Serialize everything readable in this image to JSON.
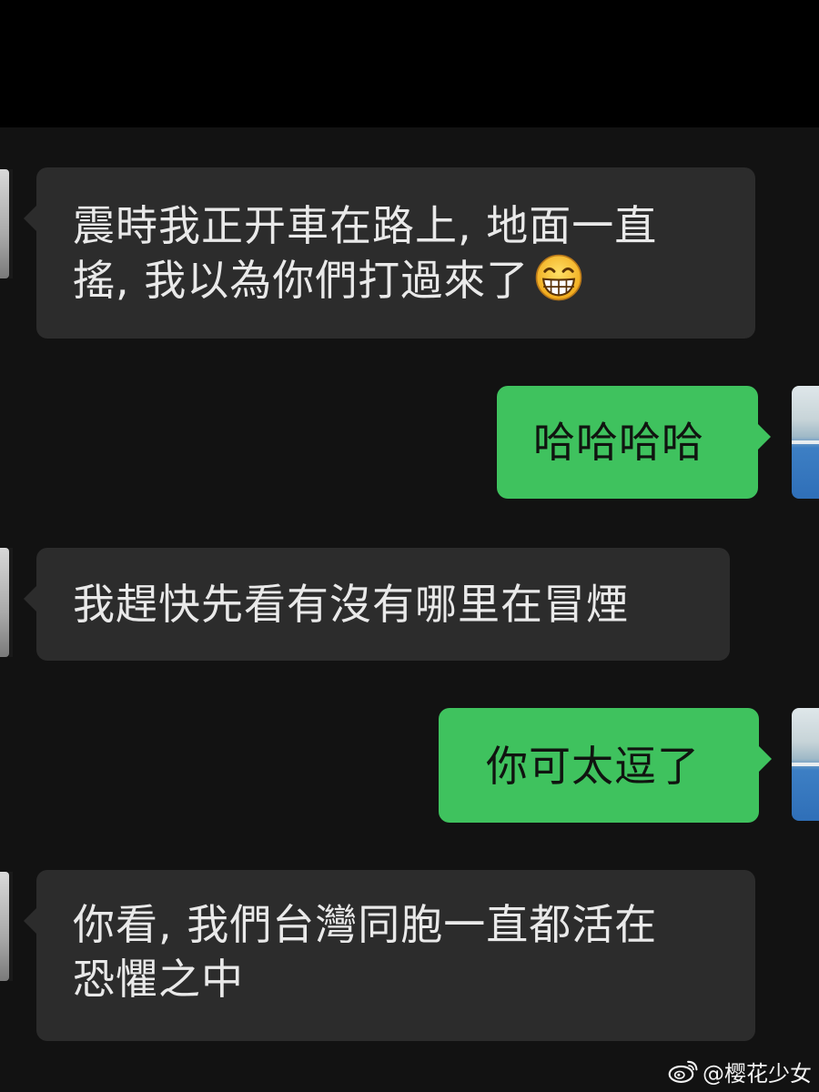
{
  "conversation": {
    "messages": [
      {
        "direction": "incoming",
        "lines": [
          "震時我正开車在路上, 地面一直",
          "搖, 我以為你們打過來了"
        ],
        "emoji": "grinning-face-emoji"
      },
      {
        "direction": "outgoing",
        "lines": [
          "哈哈哈哈"
        ]
      },
      {
        "direction": "incoming",
        "lines": [
          "我趕快先看有沒有哪里在冒煙"
        ]
      },
      {
        "direction": "outgoing",
        "lines": [
          "你可太逗了"
        ]
      },
      {
        "direction": "incoming",
        "lines": [
          "你看, 我們台灣同胞一直都活在",
          "恐懼之中"
        ]
      }
    ]
  },
  "watermark": {
    "icon": "weibo-icon",
    "text": "@樱花少女"
  },
  "colors": {
    "background": "#121212",
    "incoming_bubble": "#2c2c2c",
    "outgoing_bubble": "#3fc25e",
    "incoming_text": "#e9e9e9",
    "outgoing_text": "#101410"
  }
}
